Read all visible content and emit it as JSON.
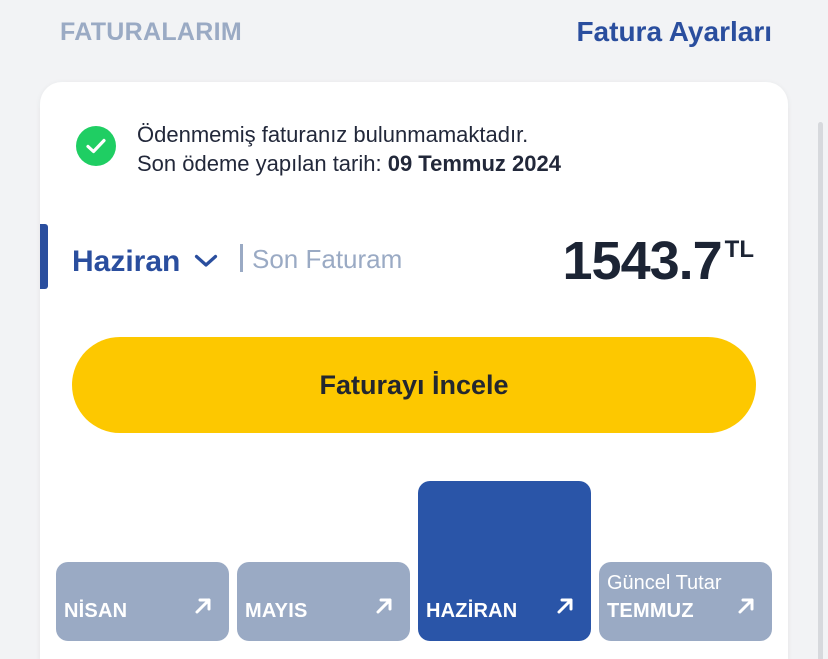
{
  "header": {
    "title": "FATURALARIM",
    "settings_link": "Fatura Ayarları"
  },
  "status": {
    "icon": "check-circle-icon",
    "line1": "Ödenmemiş faturanız bulunmamaktadır.",
    "line2_prefix": "Son ödeme yapılan tarih: ",
    "last_payment_date": "09 Temmuz 2024"
  },
  "invoice": {
    "selected_month": "Haziran",
    "caption": "Son Faturam",
    "amount": "1543.7",
    "currency": "TL"
  },
  "primary_action": {
    "label": "Faturayı İncele"
  },
  "months": [
    {
      "label": "NİSAN",
      "sub": "",
      "selected": false
    },
    {
      "label": "MAYIS",
      "sub": "",
      "selected": false
    },
    {
      "label": "HAZİRAN",
      "sub": "",
      "selected": true
    },
    {
      "label": "TEMMUZ",
      "sub": "Güncel Tutar",
      "selected": false
    }
  ],
  "colors": {
    "brand_blue": "#2a4e9e",
    "muted_blue": "#9aaac4",
    "yellow": "#fdc800",
    "success_green": "#1fce63",
    "tile_inactive": "#9aaac4",
    "tile_active": "#2a55a8"
  }
}
